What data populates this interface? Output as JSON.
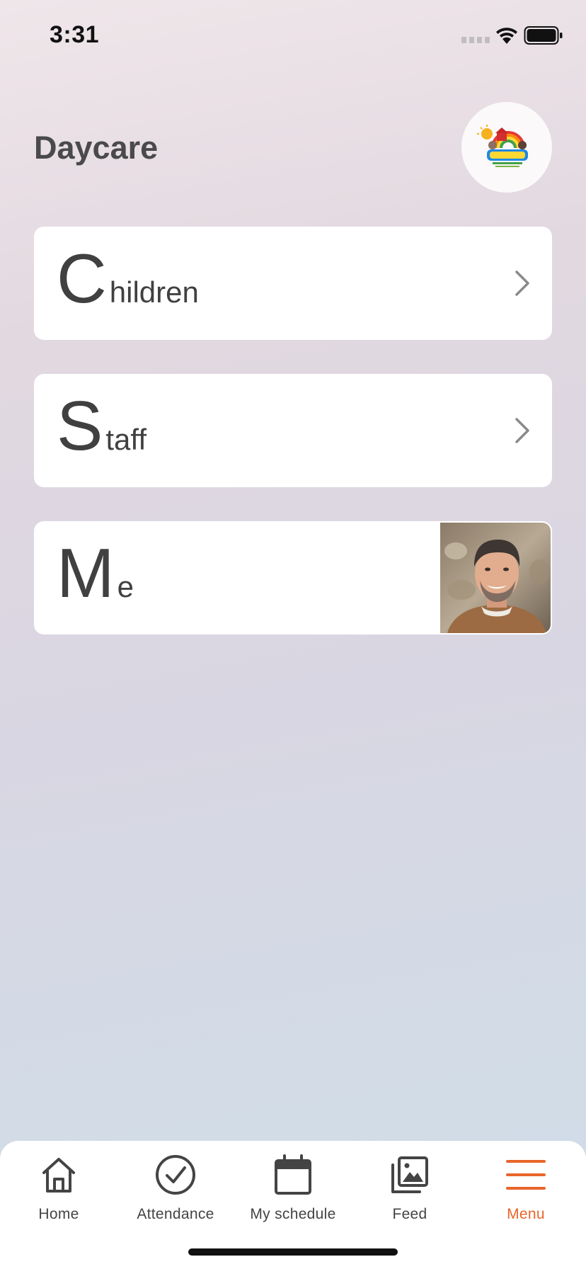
{
  "status_bar": {
    "time": "3:31"
  },
  "header": {
    "title": "Daycare",
    "logo_icon": "daycare-logo-icon"
  },
  "cards": [
    {
      "first_letter": "C",
      "rest": "hildren",
      "icon": "chevron-right-icon"
    },
    {
      "first_letter": "S",
      "rest": "taff",
      "icon": "chevron-right-icon"
    },
    {
      "first_letter": "M",
      "rest": "e",
      "icon": "profile-photo"
    }
  ],
  "tab_bar": {
    "items": [
      {
        "label": "Home",
        "icon": "home-icon"
      },
      {
        "label": "Attendance",
        "icon": "checkmark-circle-icon"
      },
      {
        "label": "My schedule",
        "icon": "calendar-icon"
      },
      {
        "label": "Feed",
        "icon": "gallery-icon"
      },
      {
        "label": "Menu",
        "icon": "hamburger-menu-icon",
        "active": true
      }
    ],
    "active_color": "#e8652a",
    "inactive_color": "#444444"
  }
}
